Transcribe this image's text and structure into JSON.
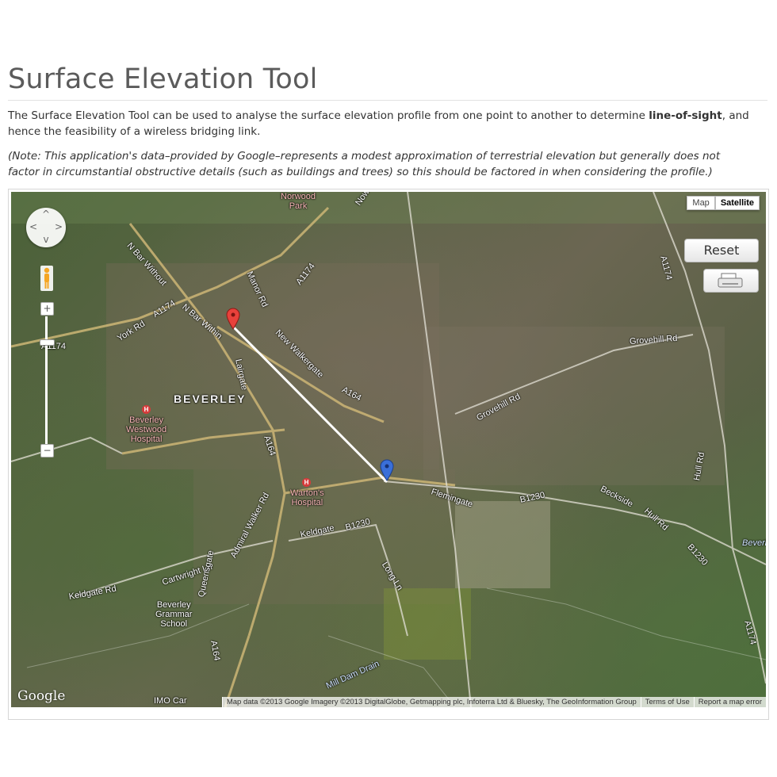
{
  "page": {
    "title": "Surface Elevation Tool",
    "intro_before": "The Surface Elevation Tool can be used to analyse the surface elevation profile from one point to another to determine ",
    "intro_bold": "line-of-sight",
    "intro_after": ", and hence the feasibility of a wireless bridging link.",
    "note": "(Note: This application's data–provided by Google–represents a modest approximation of terrestrial elevation but generally does not factor in circumstantial obstructive details (such as buildings and trees) so this should be factored in when considering the profile.)"
  },
  "map": {
    "maptype": {
      "map_label": "Map",
      "satellite_label": "Satellite",
      "selected": "Satellite"
    },
    "reset_label": "Reset",
    "print_icon": "printer-icon",
    "zoom_in_label": "+",
    "zoom_out_label": "−",
    "logo": "Google",
    "attribution": {
      "data": "Map data ©2013 Google Imagery ©2013 DigitalGlobe, Getmapping plc, Infoterra Ltd & Bluesky, The GeoInformation Group",
      "terms": "Terms of Use",
      "report": "Report a map error"
    },
    "markers": {
      "start_color": "#e8413b",
      "end_color": "#3a6fd8"
    },
    "labels": {
      "norwood_park": "Norwood\nPark",
      "north_bar_without": "N Bar Without",
      "york_rd": "York Rd",
      "a1174_west": "A1174",
      "a1174_w2": "A1174",
      "n_bar_within": "N Bar Within",
      "manor_rd": "Manor Rd",
      "a1174_north": "A1174",
      "new_walkergate": "New Walkergate",
      "lairgate": "Lairgate",
      "a164_center": "A164",
      "a164_south": "A164",
      "a164_west": "A164",
      "beverley": "BEVERLEY",
      "westwood_hospital": "Beverley\nWestwood\nHospital",
      "wartons_hospital": "Warton's\nHospital",
      "admiral_walker": "Admiral Walker Rd",
      "keldgate": "Keldgate",
      "b1230_keldgate": "B1230",
      "long_ln": "Long Ln",
      "flemingate": "Flemingate",
      "b1230_east": "B1230",
      "beckside": "Beckside",
      "hull_rd": "Hull Rd",
      "b1230_far": "B1230",
      "grovehill_rd": "Grovehill Rd",
      "grovehill_rd2": "Grovehill Rd",
      "hull_rd_vertical": "Hull Rd",
      "a1174_east": "A1174",
      "a1174_se": "A1174",
      "cartwright_ln": "Cartwright Ln",
      "keldgate_rd": "Keldgate Rd",
      "grammar_school": "Beverley\nGrammar\nSchool",
      "queensgate": "Queensgate",
      "mill_dam_drain": "Mill Dam Drain",
      "beverley_edge": "Beverl",
      "imo_car": "IMO Car",
      "north_top": "Now"
    }
  }
}
